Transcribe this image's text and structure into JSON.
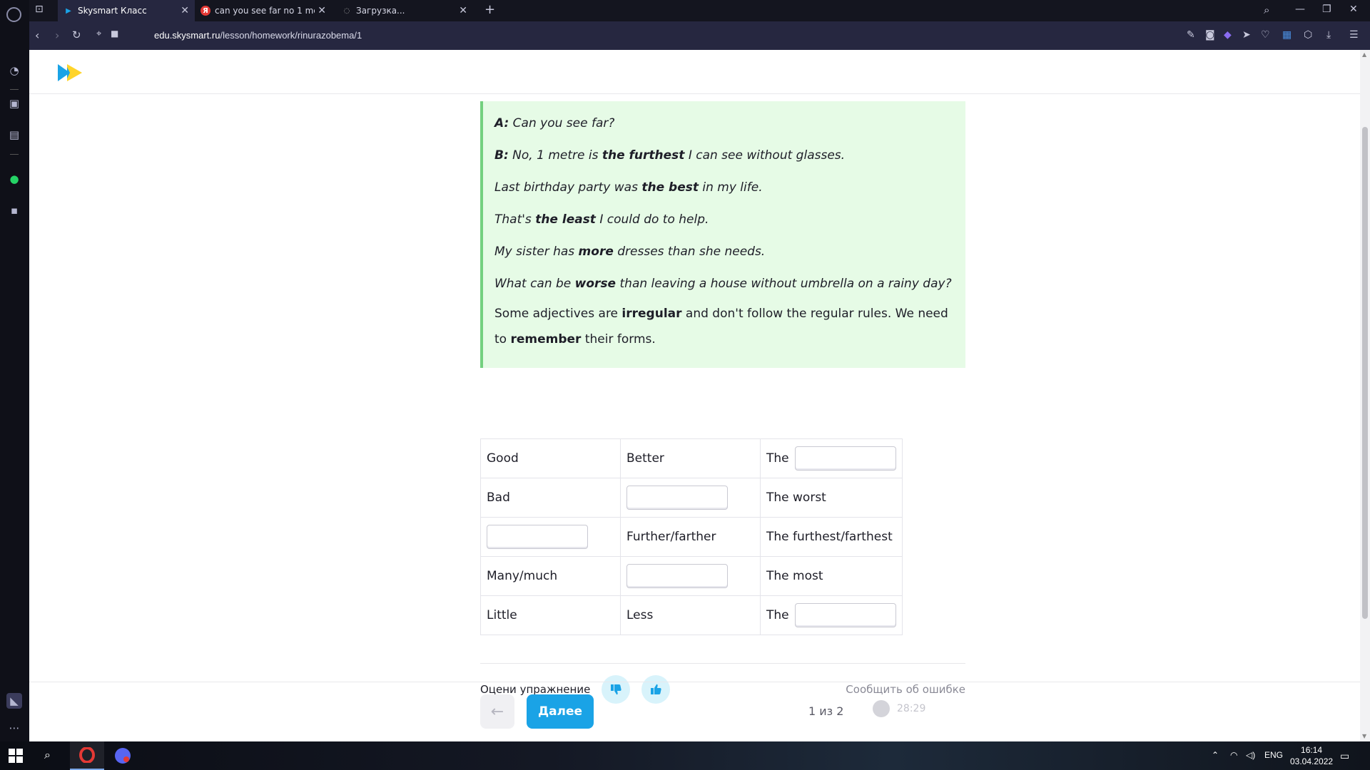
{
  "browser": {
    "tabs": [
      {
        "title": "Skysmart Класс",
        "active": true
      },
      {
        "title": "can you see far no 1 metre",
        "active": false
      },
      {
        "title": "Загрузка...",
        "active": false
      }
    ],
    "url_host": "edu.skysmart.ru",
    "url_path": "/lesson/homework/rinurazobema/1"
  },
  "tip": {
    "line1_speaker": "A:",
    "line1_text": " Can you see far?",
    "line2_speaker": "B:",
    "line2_pre": " No, 1 metre is ",
    "line2_bold": "the furthest",
    "line2_post": " I can see without glasses.",
    "line3_pre": "Last birthday party was ",
    "line3_bold": "the best",
    "line3_post": " in my life.",
    "line4_pre": "That's ",
    "line4_bold": "the least",
    "line4_post": " I could do to help.",
    "line5_pre": "My sister has ",
    "line5_bold": "more",
    "line5_post": " dresses than she needs.",
    "line6_pre": "What can be ",
    "line6_bold": "worse",
    "line6_post": " than leaving a house without umbrella on a rainy day?",
    "rule_pre": "Some adjectives are ",
    "rule_bold1": "irregular",
    "rule_mid": " and don't follow the regular rules. We need to ",
    "rule_bold2": "remember",
    "rule_post": " their forms."
  },
  "table": {
    "r1": {
      "c1": "Good",
      "c2": "Better",
      "c3_prefix": "The"
    },
    "r2": {
      "c1": "Bad",
      "c3": "The worst"
    },
    "r3": {
      "c2": "Further/farther",
      "c3": "The furthest/farthest"
    },
    "r4": {
      "c1": "Many/much",
      "c3": "The most"
    },
    "r5": {
      "c1": "Little",
      "c2": "Less",
      "c3_prefix": "The"
    }
  },
  "rating": {
    "label": "Оцени упражнение",
    "report": "Сообщить об ошибке"
  },
  "footer": {
    "next_label": "Далее",
    "pager": "1 из 2",
    "timer": "28:29"
  },
  "taskbar": {
    "lang": "ENG",
    "time": "16:14",
    "date": "03.04.2022"
  },
  "colors": {
    "accent": "#1aa3e6",
    "tip_bg": "#e6fbe6",
    "tip_border": "#73d07f"
  }
}
